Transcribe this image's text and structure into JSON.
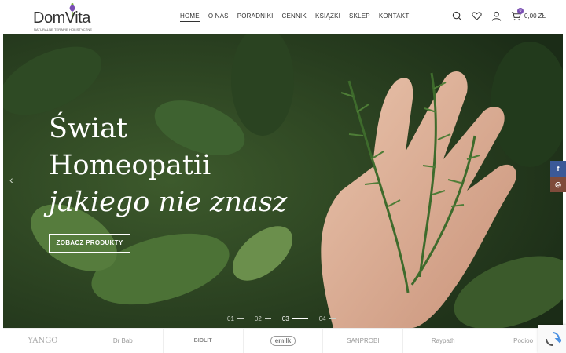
{
  "header": {
    "logo_text": "DomVita",
    "logo_tagline": "NATURALNE TERAPIE HOLISTYCZNE",
    "nav": [
      {
        "label": "HOME",
        "active": true
      },
      {
        "label": "O NAS"
      },
      {
        "label": "PORADNIKI"
      },
      {
        "label": "CENNIK"
      },
      {
        "label": "KSIĄŻKI"
      },
      {
        "label": "SKLEP"
      },
      {
        "label": "KONTAKT"
      }
    ],
    "icons": [
      "search-icon",
      "heart-icon",
      "user-icon",
      "cart-icon"
    ],
    "cart_count": "0",
    "cart_total": "0,00 ZŁ"
  },
  "hero": {
    "line1": "Świat",
    "line2": "Homeopatii",
    "line3": "jakiego nie znasz",
    "button": "ZOBACZ PRODUKTY",
    "prev_arrow": "‹",
    "slides": [
      "01",
      "02",
      "03",
      "04"
    ],
    "active_slide": 3
  },
  "social": {
    "facebook": "f",
    "instagram": "◎"
  },
  "brands": [
    "YANGO",
    "Dr Bab",
    "BIOLIT",
    "emilk",
    "SANPROBI",
    "Raypath",
    "Podioo"
  ],
  "colors": {
    "accent": "#7a4fb3",
    "facebook": "#3b5998",
    "instagram": "#7f4b3b"
  }
}
